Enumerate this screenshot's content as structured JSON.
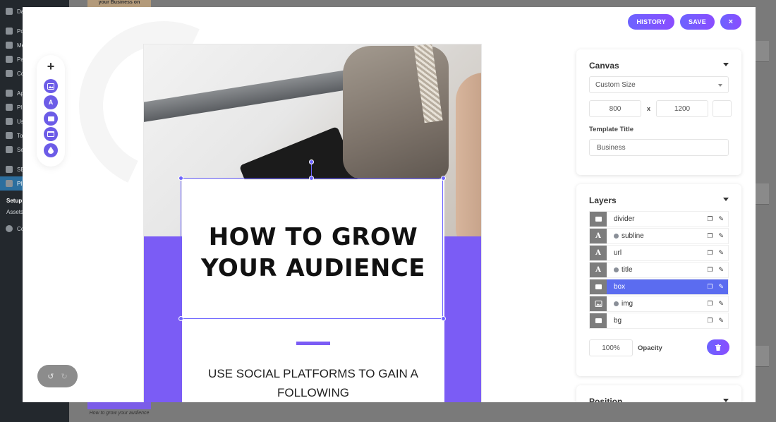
{
  "wp_admin": {
    "menu": [
      {
        "label": "Da"
      },
      {
        "label": "Po"
      },
      {
        "label": "Me"
      },
      {
        "label": "Pa"
      },
      {
        "label": "Co"
      },
      {
        "label": "Ap"
      },
      {
        "label": "Pl"
      },
      {
        "label": "Us"
      },
      {
        "label": "To"
      },
      {
        "label": "Se"
      },
      {
        "label": "SE"
      },
      {
        "label": "Pl"
      }
    ],
    "submenu": [
      "Setup",
      "Assets"
    ],
    "collapse": "Co",
    "thumb_top_text": "your Business on",
    "thumb_bottom_caption": "How to grow your audience"
  },
  "header": {
    "history_label": "HISTORY",
    "save_label": "SAVE",
    "close_label": "×"
  },
  "toolbar": {
    "add_label": "+",
    "text_tool_label": "A"
  },
  "undo": {
    "undo_icon": "↺",
    "redo_icon": "↻"
  },
  "canvas": {
    "headline_line1": "HOW TO GROW",
    "headline_line2": "YOUR AUDIENCE",
    "subline": "USE SOCIAL PLATFORMS TO GAIN A FOLLOWING",
    "colors": {
      "accent": "#7b5cf5",
      "headline": "#111111"
    }
  },
  "panel_canvas": {
    "title": "Canvas",
    "size_select": "Custom Size",
    "width": "800",
    "times": "x",
    "height": "1200",
    "template_title_label": "Template Title",
    "template_title_value": "Business"
  },
  "panel_layers": {
    "title": "Layers",
    "rows": [
      {
        "name": "divider",
        "type": "rect",
        "dot": false,
        "selected": false
      },
      {
        "name": "subline",
        "type": "text",
        "dot": true,
        "selected": false
      },
      {
        "name": "url",
        "type": "text",
        "dot": false,
        "selected": false
      },
      {
        "name": "title",
        "type": "text",
        "dot": true,
        "selected": false
      },
      {
        "name": "box",
        "type": "rect",
        "dot": false,
        "selected": true
      },
      {
        "name": "img",
        "type": "image",
        "dot": true,
        "selected": false
      },
      {
        "name": "bg",
        "type": "rect",
        "dot": false,
        "selected": false
      }
    ],
    "opacity_value": "100%",
    "opacity_label": "Opacity"
  },
  "panel_position": {
    "title": "Position"
  }
}
